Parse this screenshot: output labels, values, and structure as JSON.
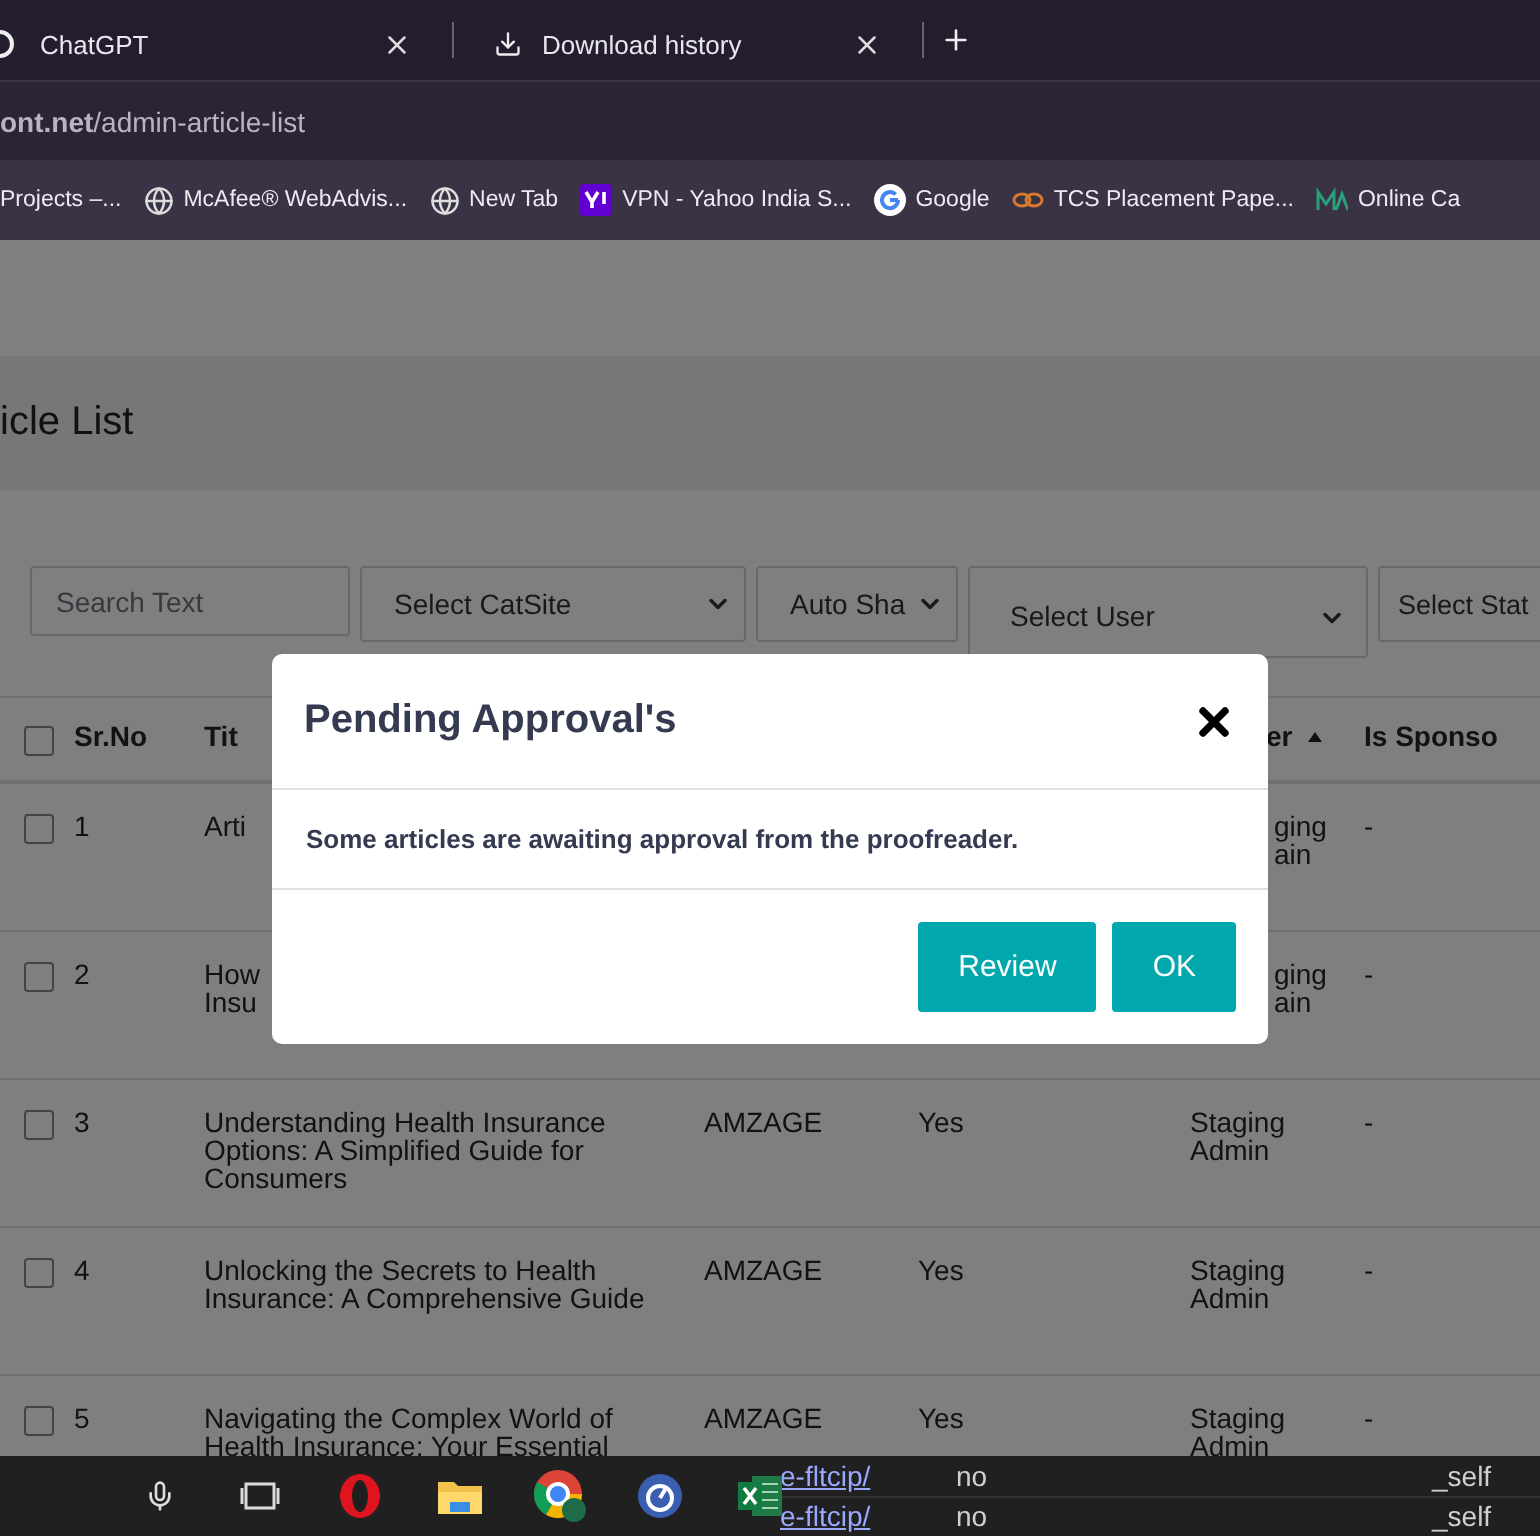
{
  "tabs": [
    {
      "title": "ChatGPT",
      "selected": false
    },
    {
      "title": "Download history",
      "selected": false
    }
  ],
  "address": "**ont.net**/admin-article-list",
  "bookmarks": [
    {
      "label": "Projects –..."
    },
    {
      "label": "McAfee® WebAdvis..."
    },
    {
      "label": "New Tab"
    },
    {
      "label": "VPN - Yahoo India S..."
    },
    {
      "label": "Google"
    },
    {
      "label": "TCS Placement Pape..."
    },
    {
      "label": "Online Ca"
    }
  ],
  "page": {
    "title": "icle List",
    "filters": [
      {
        "kind": "input",
        "placeholder": "Search Text"
      },
      {
        "kind": "select",
        "value": "Select CatSite"
      },
      {
        "kind": "select",
        "value": "Auto Sha"
      },
      {
        "kind": "select",
        "value": "Select User"
      },
      {
        "kind": "select",
        "value": "Select Stat"
      }
    ],
    "all_checked": false,
    "columns": [
      {
        "label": "Sr.No"
      },
      {
        "label": "Tit"
      },
      {
        "label": "er",
        "sorted": true
      },
      {
        "label": "Is Sponso"
      }
    ],
    "rows": [
      {
        "checked": false,
        "sr": "1",
        "title": "Arti",
        "user": "ging\nain",
        "cut": true,
        "sponsored": "-"
      },
      {
        "checked": false,
        "sr": "2",
        "title": "How\nInsu",
        "user": "ging\nain",
        "cut": true,
        "sponsored": "-"
      },
      {
        "checked": false,
        "sr": "3",
        "title": "Understanding Health Insurance Options: A Simplified Guide for Consumers",
        "site": "AMZAGE",
        "auto": "Yes",
        "user": "Staging Admin",
        "cut": false,
        "sponsored": "-"
      },
      {
        "checked": false,
        "sr": "4",
        "title": "Unlocking the Secrets to Health Insurance: A Comprehensive Guide",
        "site": "AMZAGE",
        "auto": "Yes",
        "user": "Staging Admin",
        "cut": false,
        "sponsored": "-"
      },
      {
        "checked": false,
        "sr": "5",
        "title": "Navigating the Complex World of Health Insurance: Your Essential",
        "site": "AMZAGE",
        "auto": "Yes",
        "user": "Staging Admin",
        "cut": false,
        "sponsored": "-"
      }
    ]
  },
  "modal": {
    "title": "Pending Approval's",
    "message": "Some articles are awaiting approval from the proofreader.",
    "buttons": [
      "Review",
      "OK"
    ]
  },
  "taskbar": {
    "rows": [
      {
        "link": "e-fltcip/",
        "value": "no",
        "target": "_self"
      },
      {
        "link": "e-fltcip/",
        "value": "no",
        "target": "_self"
      }
    ]
  }
}
